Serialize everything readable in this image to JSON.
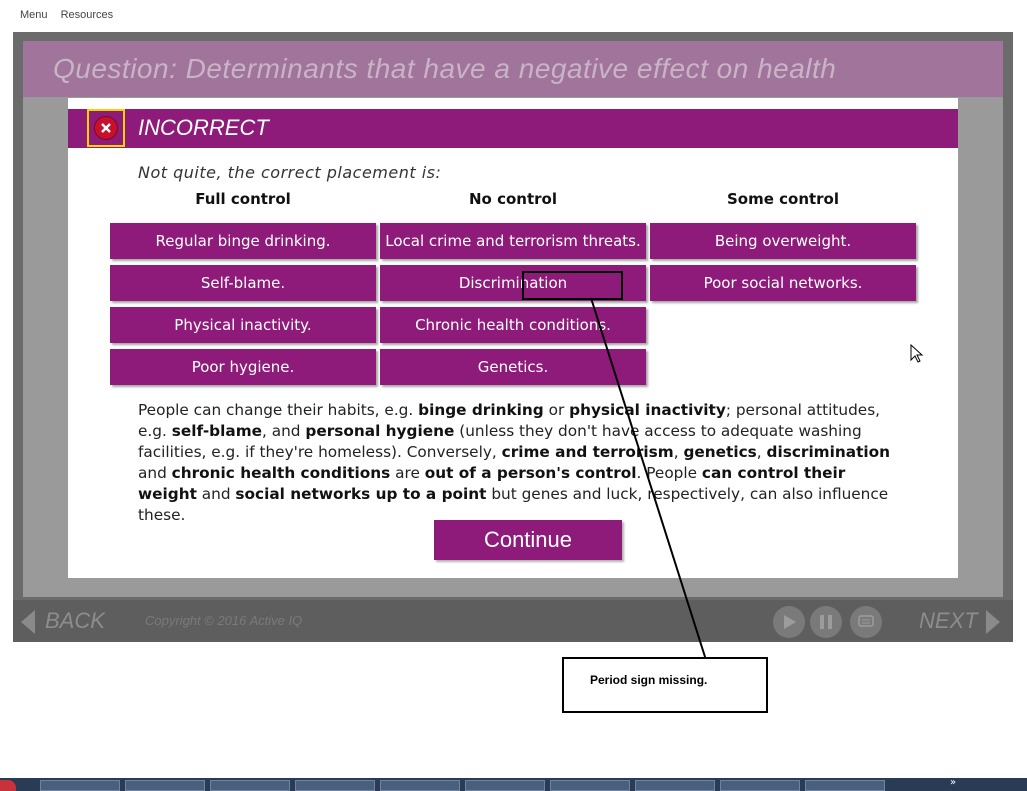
{
  "topnav": {
    "menu": "Menu",
    "resources": "Resources"
  },
  "question": {
    "title": "Question: Determinants that have a negative effect on health"
  },
  "feedback": {
    "status": "INCORRECT",
    "subtitle": "Not quite, the correct placement is:",
    "columns": [
      "Full control",
      "No control",
      "Some control"
    ],
    "full_control": [
      "Regular binge drinking.",
      "Self-blame.",
      "Physical inactivity.",
      "Poor hygiene."
    ],
    "no_control": [
      "Local crime and terrorism threats.",
      "Discrimination",
      "Chronic health conditions.",
      "Genetics."
    ],
    "some_control": [
      "Being overweight.",
      "Poor social networks."
    ],
    "explanation": {
      "t1": "People can change their habits, e.g. ",
      "b1": "binge drinking",
      "t2": " or ",
      "b2": "physical inactivity",
      "t3": "; personal attitudes, e.g. ",
      "b3": "self-blame",
      "t4": ", and ",
      "b4": "personal hygiene",
      "t5": " (unless they don't have access to adequate washing facilities, e.g. if they're homeless). Conversely, ",
      "b5": "crime and terrorism",
      "t6": ", ",
      "b6": "genetics",
      "t7": ", ",
      "b7": "discrimination",
      "t8": " and ",
      "b8": "chronic health conditions",
      "t9": " are ",
      "b9": "out of a person's control",
      "t10": ". People ",
      "b10": "can control their weight",
      "t11": " and ",
      "b11": "social networks up to a point",
      "t12": " but genes and luck, respectively, can also influence these."
    },
    "continue_label": "Continue"
  },
  "player": {
    "back_label": "BACK",
    "next_label": "NEXT",
    "copyright": "Copyright © 2016 Active IQ",
    "controls": [
      "play-icon",
      "pause-icon",
      "transcript-icon"
    ]
  },
  "annotation": {
    "note": "Period sign missing."
  },
  "colors": {
    "accent": "#8e1b7a",
    "frame": "#6b6b6b"
  }
}
